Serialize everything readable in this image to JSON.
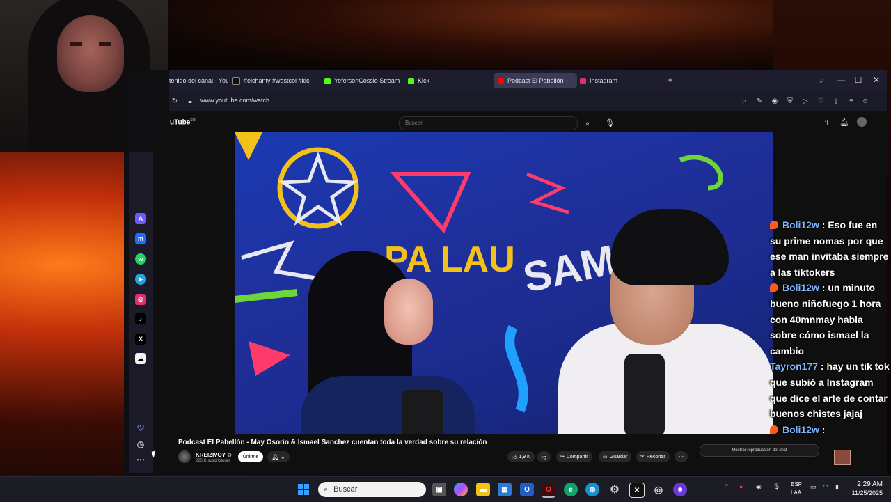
{
  "browser": {
    "tabs": [
      {
        "label": "tenido del canal - You",
        "fav_color": "#ff0000"
      },
      {
        "label": "#elchanty #westcol #kick",
        "fav_color": "#111111"
      },
      {
        "label": "YefersonCossio Stream - V",
        "fav_color": "#53fc18"
      },
      {
        "label": "Kick",
        "fav_color": "#53fc18"
      },
      {
        "label": "Podcast El Pabellón -",
        "fav_color": "#ff0000"
      },
      {
        "label": "Instagram",
        "fav_color": "#e1306c"
      }
    ],
    "new_tab": "+",
    "url": "www.youtube.com/watch"
  },
  "youtube": {
    "logo": "uTube",
    "logo_sup": "CO",
    "search_placeholder": "Buscar",
    "video_title": "Podcast El Pabellón - May Osorio & Ismael Sanchez cuentan toda la verdad sobre su relación",
    "channel_name": "KREIZIVOY",
    "subscribers": "285 K suscriptores",
    "join_label": "Únirme",
    "likes": "1,9 K",
    "share_label": "Compartir",
    "save_label": "Guardar",
    "clip_label": "Recortar",
    "show_chat": "Mostrar reproducción del chat"
  },
  "chat": [
    {
      "user": "Boli12w",
      "text": ": Eso fue en su prime nomas por que ese man invitaba siempre a las tiktokers",
      "fire": true
    },
    {
      "user": "Boli12w",
      "text": ": un minuto bueno niñofuego 1 hora con 40mnmay habla sobre cómo ismael la cambio",
      "fire": true
    },
    {
      "user": "Tayron177",
      "text": ": hay un tik tok que subió a Instagram que dice el arte de contar buenos chistes jajaj",
      "fire": false
    },
    {
      "user": "Boli12w",
      "text": ":",
      "fire": true
    }
  ],
  "taskbar": {
    "search_placeholder": "Buscar",
    "lang1": "ESP",
    "lang2": "LAA",
    "time": "2:29 AM",
    "date": "11/25/2025"
  },
  "colors": {
    "accent_youtube": "#ff0000",
    "kick_green": "#53fc18",
    "chat_user": "#7eb6ff"
  }
}
